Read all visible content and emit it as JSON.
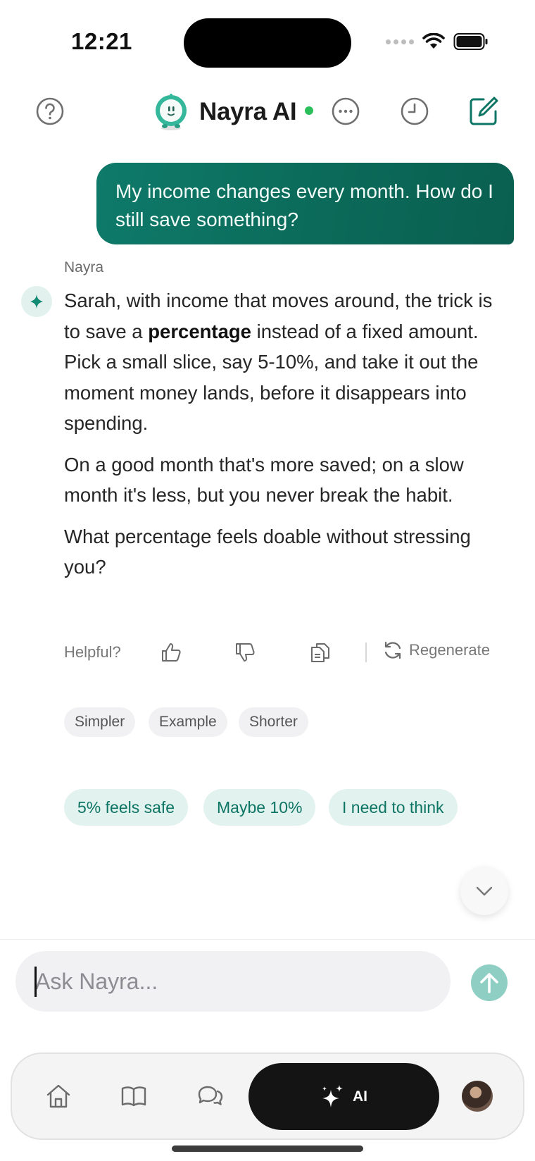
{
  "status_bar": {
    "time": "12:21"
  },
  "header": {
    "title": "Nayra AI",
    "online_color": "#2bbf5b"
  },
  "user_message": {
    "text": "My income changes every month. How do I still save something?"
  },
  "assistant": {
    "name": "Nayra",
    "paragraph_1_pre": "Sarah, with income that moves around, the trick is to save a ",
    "paragraph_1_bold": "percentage",
    "paragraph_1_post": " instead of a fixed amount. Pick a small slice, say 5-10%, and take it out the moment money lands, before it disappears into spending.",
    "paragraph_2": "On a good month that's more saved; on a slow month it's less, but you never break the habit.",
    "paragraph_3": "What percentage feels doable without stressing you?"
  },
  "feedback": {
    "helpful_label": "Helpful?",
    "regenerate_label": "Regenerate"
  },
  "refine_chips": [
    "Simpler",
    "Example",
    "Shorter"
  ],
  "quick_replies": [
    "5% feels safe",
    "Maybe 10%",
    "I need to think"
  ],
  "composer": {
    "placeholder": "Ask Nayra...",
    "value": ""
  },
  "tabbar": {
    "ai_label": "AI",
    "active_tab": "AI"
  },
  "colors": {
    "accent": "#0d7564",
    "bubble": "#0b6a59",
    "send_disabled": "#8fcfc3"
  }
}
